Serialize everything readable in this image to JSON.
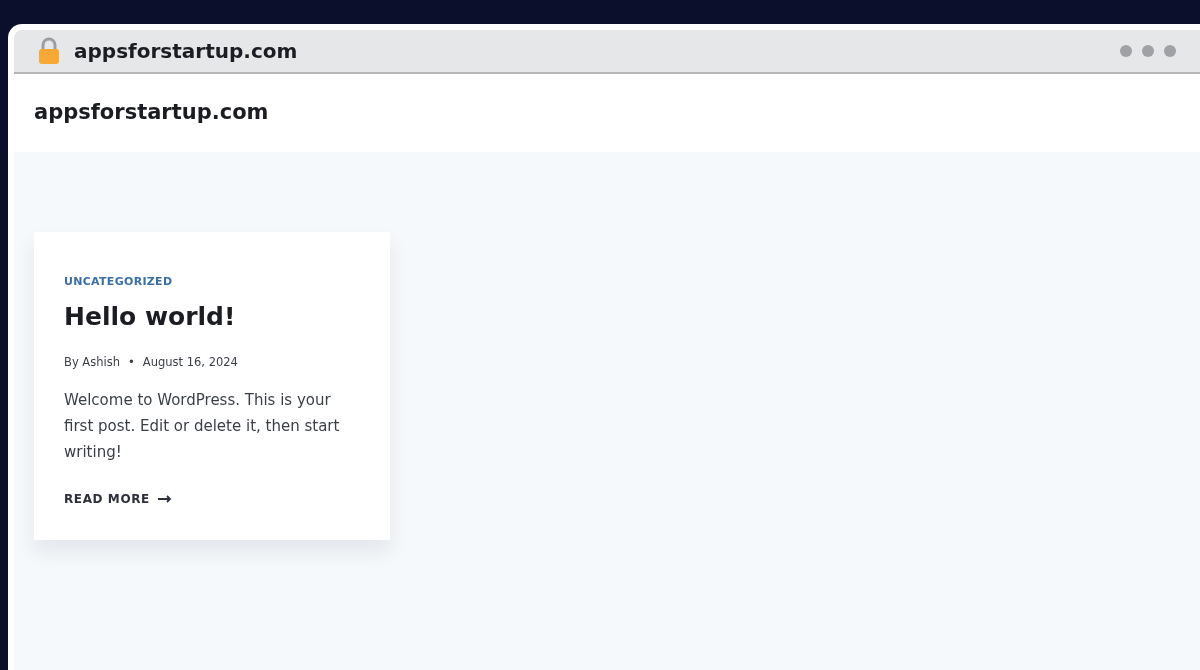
{
  "browser": {
    "address": "appsforstartup.com"
  },
  "site": {
    "title": "appsforstartup.com"
  },
  "posts": [
    {
      "category": "UNCATEGORIZED",
      "title": "Hello world!",
      "author": "By Ashish",
      "separator": "•",
      "date": "August 16, 2024",
      "excerpt": "Welcome to WordPress. This is your first post. Edit or delete it, then start writing!",
      "link": "READ MORE"
    }
  ]
}
